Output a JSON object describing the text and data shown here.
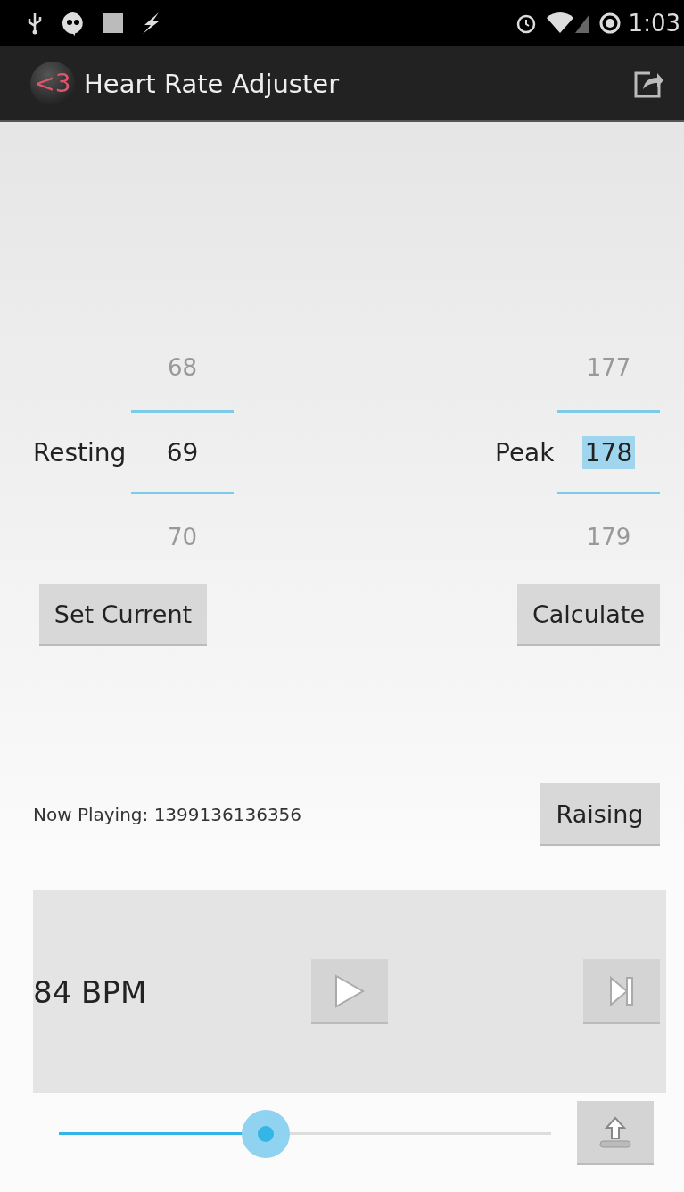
{
  "status_bar": {
    "time": "1:03"
  },
  "action_bar": {
    "logo": "<3",
    "title": "Heart Rate Adjuster"
  },
  "pickers": [
    {
      "label": "Resting",
      "above": "68",
      "value": "69",
      "below": "70",
      "text_selected": false
    },
    {
      "label": "Peak",
      "above": "177",
      "value": "178",
      "below": "179",
      "text_selected": true
    }
  ],
  "buttons": [
    "Set Current",
    "Calculate"
  ],
  "now_playing": {
    "text": "Now Playing: 1399136136356",
    "button": "Raising"
  },
  "player": {
    "bpm": "84 BPM"
  },
  "seek": {
    "level": 0.42
  }
}
